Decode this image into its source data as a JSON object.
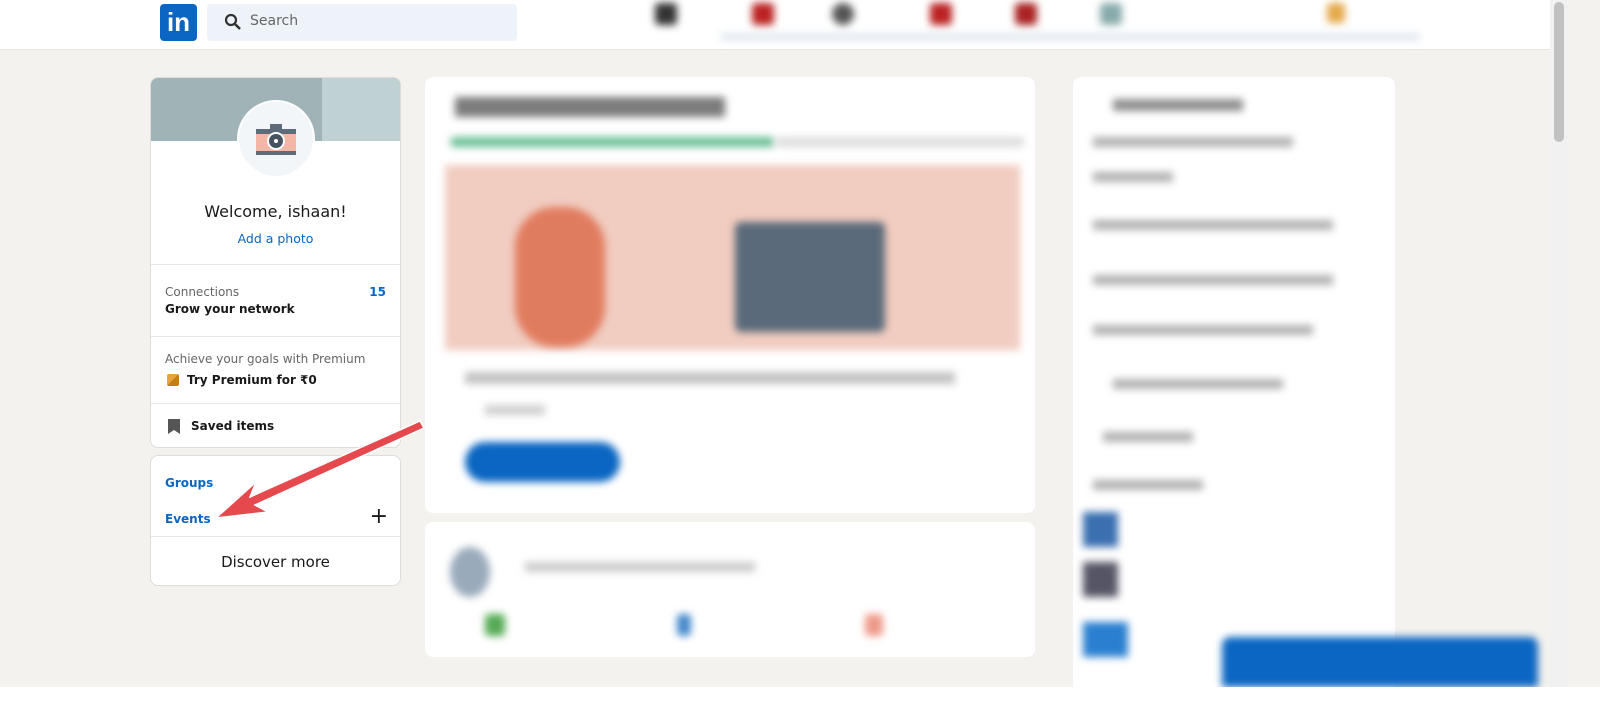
{
  "header": {
    "logo": "in",
    "search_placeholder": "Search"
  },
  "profile": {
    "welcome": "Welcome, ishaan!",
    "add_photo": "Add a photo",
    "connections_label": "Connections",
    "connections_count": "15",
    "grow": "Grow your network",
    "premium_text": "Achieve your goals with Premium",
    "premium_cta": "Try Premium for ₹0",
    "saved": "Saved items"
  },
  "community": {
    "groups": "Groups",
    "events": "Events",
    "add": "+",
    "discover": "Discover more"
  },
  "colors": {
    "brand": "#0a66c2",
    "arrow": "#e5484d",
    "background": "#f4f2ee"
  }
}
